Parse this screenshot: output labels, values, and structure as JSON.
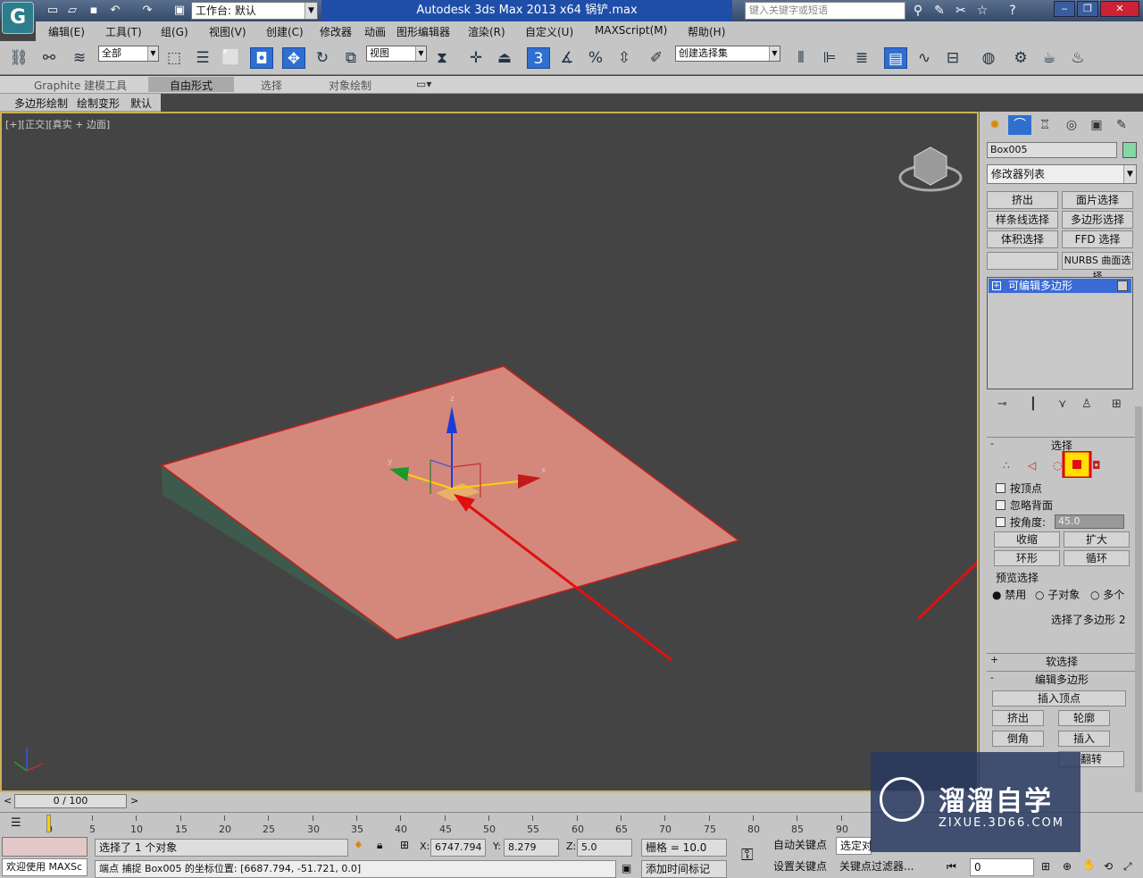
{
  "titlebar": {
    "workspace": "工作台: 默认",
    "title": "Autodesk 3ds Max  2013 x64      锅铲.max",
    "search_placeholder": "键入关键字或短语"
  },
  "menu": [
    "编辑(E)",
    "工具(T)",
    "组(G)",
    "视图(V)",
    "创建(C)",
    "修改器",
    "动画",
    "图形编辑器",
    "渲染(R)",
    "自定义(U)",
    "MAXScript(M)",
    "帮助(H)"
  ],
  "toolbar": {
    "filter": "全部",
    "refcoord": "视图",
    "selset": "创建选择集"
  },
  "ribbon": {
    "tabs": [
      "Graphite 建模工具",
      "自由形式",
      "选择",
      "对象绘制"
    ],
    "sub": [
      "多边形绘制",
      "绘制变形",
      "默认"
    ]
  },
  "viewport": {
    "label": "[+][正交][真实 + 边面]"
  },
  "cmdpanel": {
    "object_name": "Box005",
    "color": "#86d6a6",
    "modifier_list": "修改器列表",
    "buttons": [
      "挤出",
      "面片选择",
      "样条线选择",
      "多边形选择",
      "体积选择",
      "FFD 选择",
      "",
      "NURBS 曲面选择"
    ],
    "stack_item": "可编辑多边形",
    "sel_title": "选择",
    "by_vertex": "按顶点",
    "ignore_back": "忽略背面",
    "by_angle": "按角度:",
    "angle_value": "45.0",
    "shrink": "收缩",
    "grow": "扩大",
    "ring": "环形",
    "loop": "循环",
    "preview": "预览选择",
    "disable": "禁用",
    "subobj": "子对象",
    "multi": "多个",
    "selected_info": "选择了多边形 2",
    "soft_sel": "软选择",
    "edit_poly": "编辑多边形",
    "insert_vertex": "插入顶点",
    "extrude": "挤出",
    "outline": "轮廓",
    "bevel": "倒角",
    "inset": "插入",
    "flip": "翻转"
  },
  "timeline": {
    "slider": "0 / 100",
    "ticks": [
      "0",
      "5",
      "10",
      "15",
      "20",
      "25",
      "30",
      "35",
      "40",
      "45",
      "50",
      "55",
      "60",
      "65",
      "70",
      "75",
      "80",
      "85",
      "90"
    ]
  },
  "status": {
    "selected": "选择了 1 个对象",
    "welcome": "欢迎使用 MAXSc",
    "prompt": "端点 捕捉 Box005 的坐标位置:  [6687.794, -51.721, 0.0]",
    "x": "6747.794",
    "y": "8.279",
    "z": "5.0",
    "grid": "栅格 = 10.0",
    "addtime": "添加时间标记",
    "autokey": "自动关键点",
    "selected_obj": "选定对",
    "setkey": "设置关键点",
    "keyfilter": "关键点过滤器...",
    "frame": "0"
  },
  "watermark": {
    "title": "溜溜自学",
    "url": "ZIXUE.3D66.COM"
  }
}
